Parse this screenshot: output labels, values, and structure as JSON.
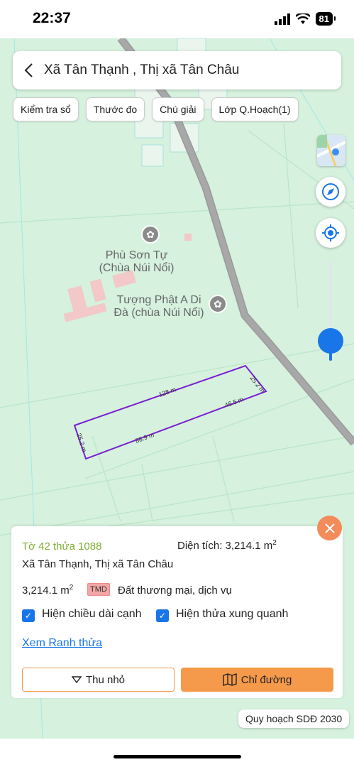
{
  "status_bar": {
    "time": "22:37",
    "battery": "81"
  },
  "header": {
    "title": "Xã Tân Thạnh , Thị xã Tân Châu"
  },
  "chips": [
    "Kiểm tra sổ",
    "Thước đo",
    "Chú giải",
    "Lớp Q.Hoạch(1)"
  ],
  "map": {
    "poi_1": [
      "Phù Sơn Tự",
      "(Chùa Núi Nổi)"
    ],
    "poi_2": [
      "Tượng Phật A Di",
      "Đà (chùa Núi Nổi)"
    ],
    "edges": {
      "top": "128 m",
      "right": "25.2 m",
      "bottom_right": "46.5 m",
      "bottom": "88.9 m",
      "left": "25.2 m"
    },
    "parcel_color": "#7a1fd1",
    "road_color": "#9a9a9a"
  },
  "parcel": {
    "id": "Tờ 42 thửa 1088",
    "area_label": "Diện tích: 3,214.1 m",
    "area_sup": "2",
    "address": "Xã Tân Thạnh, Thị xã Tân Châu",
    "area_value": "3,214.1 m",
    "area_value_sup": "2",
    "land_code": "TMD",
    "land_use": "Đất thương mại, dịch vụ",
    "option_1": "Hiện chiều dài cạnh",
    "option_2": "Hiện thửa xung quanh",
    "link": "Xem Ranh thửa",
    "btn_collapse": "Thu nhỏ",
    "btn_directions": "Chỉ đường"
  },
  "zoom_level": 0.3,
  "plan_tag": "Quy hoạch SDĐ 2030",
  "accent": "#1976e8",
  "orange": "#f59a4a"
}
